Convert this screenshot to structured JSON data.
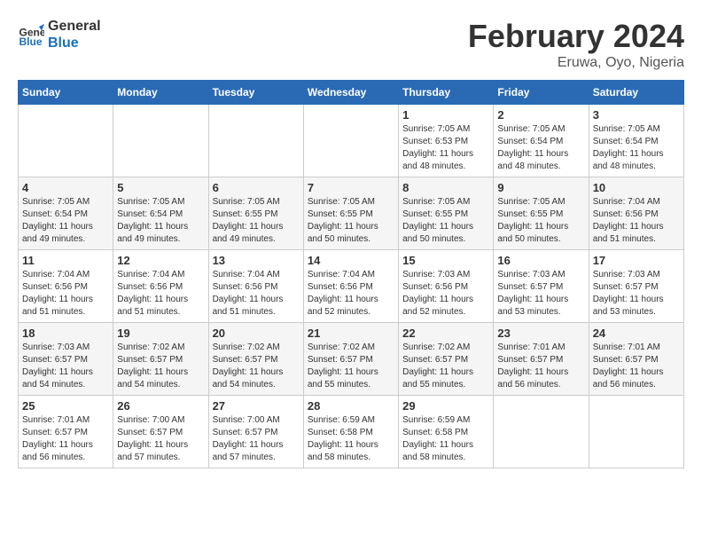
{
  "header": {
    "logo_line1": "General",
    "logo_line2": "Blue",
    "month_year": "February 2024",
    "location": "Eruwa, Oyo, Nigeria"
  },
  "weekdays": [
    "Sunday",
    "Monday",
    "Tuesday",
    "Wednesday",
    "Thursday",
    "Friday",
    "Saturday"
  ],
  "weeks": [
    [
      {
        "day": "",
        "info": ""
      },
      {
        "day": "",
        "info": ""
      },
      {
        "day": "",
        "info": ""
      },
      {
        "day": "",
        "info": ""
      },
      {
        "day": "1",
        "info": "Sunrise: 7:05 AM\nSunset: 6:53 PM\nDaylight: 11 hours\nand 48 minutes."
      },
      {
        "day": "2",
        "info": "Sunrise: 7:05 AM\nSunset: 6:54 PM\nDaylight: 11 hours\nand 48 minutes."
      },
      {
        "day": "3",
        "info": "Sunrise: 7:05 AM\nSunset: 6:54 PM\nDaylight: 11 hours\nand 48 minutes."
      }
    ],
    [
      {
        "day": "4",
        "info": "Sunrise: 7:05 AM\nSunset: 6:54 PM\nDaylight: 11 hours\nand 49 minutes."
      },
      {
        "day": "5",
        "info": "Sunrise: 7:05 AM\nSunset: 6:54 PM\nDaylight: 11 hours\nand 49 minutes."
      },
      {
        "day": "6",
        "info": "Sunrise: 7:05 AM\nSunset: 6:55 PM\nDaylight: 11 hours\nand 49 minutes."
      },
      {
        "day": "7",
        "info": "Sunrise: 7:05 AM\nSunset: 6:55 PM\nDaylight: 11 hours\nand 50 minutes."
      },
      {
        "day": "8",
        "info": "Sunrise: 7:05 AM\nSunset: 6:55 PM\nDaylight: 11 hours\nand 50 minutes."
      },
      {
        "day": "9",
        "info": "Sunrise: 7:05 AM\nSunset: 6:55 PM\nDaylight: 11 hours\nand 50 minutes."
      },
      {
        "day": "10",
        "info": "Sunrise: 7:04 AM\nSunset: 6:56 PM\nDaylight: 11 hours\nand 51 minutes."
      }
    ],
    [
      {
        "day": "11",
        "info": "Sunrise: 7:04 AM\nSunset: 6:56 PM\nDaylight: 11 hours\nand 51 minutes."
      },
      {
        "day": "12",
        "info": "Sunrise: 7:04 AM\nSunset: 6:56 PM\nDaylight: 11 hours\nand 51 minutes."
      },
      {
        "day": "13",
        "info": "Sunrise: 7:04 AM\nSunset: 6:56 PM\nDaylight: 11 hours\nand 51 minutes."
      },
      {
        "day": "14",
        "info": "Sunrise: 7:04 AM\nSunset: 6:56 PM\nDaylight: 11 hours\nand 52 minutes."
      },
      {
        "day": "15",
        "info": "Sunrise: 7:03 AM\nSunset: 6:56 PM\nDaylight: 11 hours\nand 52 minutes."
      },
      {
        "day": "16",
        "info": "Sunrise: 7:03 AM\nSunset: 6:57 PM\nDaylight: 11 hours\nand 53 minutes."
      },
      {
        "day": "17",
        "info": "Sunrise: 7:03 AM\nSunset: 6:57 PM\nDaylight: 11 hours\nand 53 minutes."
      }
    ],
    [
      {
        "day": "18",
        "info": "Sunrise: 7:03 AM\nSunset: 6:57 PM\nDaylight: 11 hours\nand 54 minutes."
      },
      {
        "day": "19",
        "info": "Sunrise: 7:02 AM\nSunset: 6:57 PM\nDaylight: 11 hours\nand 54 minutes."
      },
      {
        "day": "20",
        "info": "Sunrise: 7:02 AM\nSunset: 6:57 PM\nDaylight: 11 hours\nand 54 minutes."
      },
      {
        "day": "21",
        "info": "Sunrise: 7:02 AM\nSunset: 6:57 PM\nDaylight: 11 hours\nand 55 minutes."
      },
      {
        "day": "22",
        "info": "Sunrise: 7:02 AM\nSunset: 6:57 PM\nDaylight: 11 hours\nand 55 minutes."
      },
      {
        "day": "23",
        "info": "Sunrise: 7:01 AM\nSunset: 6:57 PM\nDaylight: 11 hours\nand 56 minutes."
      },
      {
        "day": "24",
        "info": "Sunrise: 7:01 AM\nSunset: 6:57 PM\nDaylight: 11 hours\nand 56 minutes."
      }
    ],
    [
      {
        "day": "25",
        "info": "Sunrise: 7:01 AM\nSunset: 6:57 PM\nDaylight: 11 hours\nand 56 minutes."
      },
      {
        "day": "26",
        "info": "Sunrise: 7:00 AM\nSunset: 6:57 PM\nDaylight: 11 hours\nand 57 minutes."
      },
      {
        "day": "27",
        "info": "Sunrise: 7:00 AM\nSunset: 6:57 PM\nDaylight: 11 hours\nand 57 minutes."
      },
      {
        "day": "28",
        "info": "Sunrise: 6:59 AM\nSunset: 6:58 PM\nDaylight: 11 hours\nand 58 minutes."
      },
      {
        "day": "29",
        "info": "Sunrise: 6:59 AM\nSunset: 6:58 PM\nDaylight: 11 hours\nand 58 minutes."
      },
      {
        "day": "",
        "info": ""
      },
      {
        "day": "",
        "info": ""
      }
    ]
  ]
}
